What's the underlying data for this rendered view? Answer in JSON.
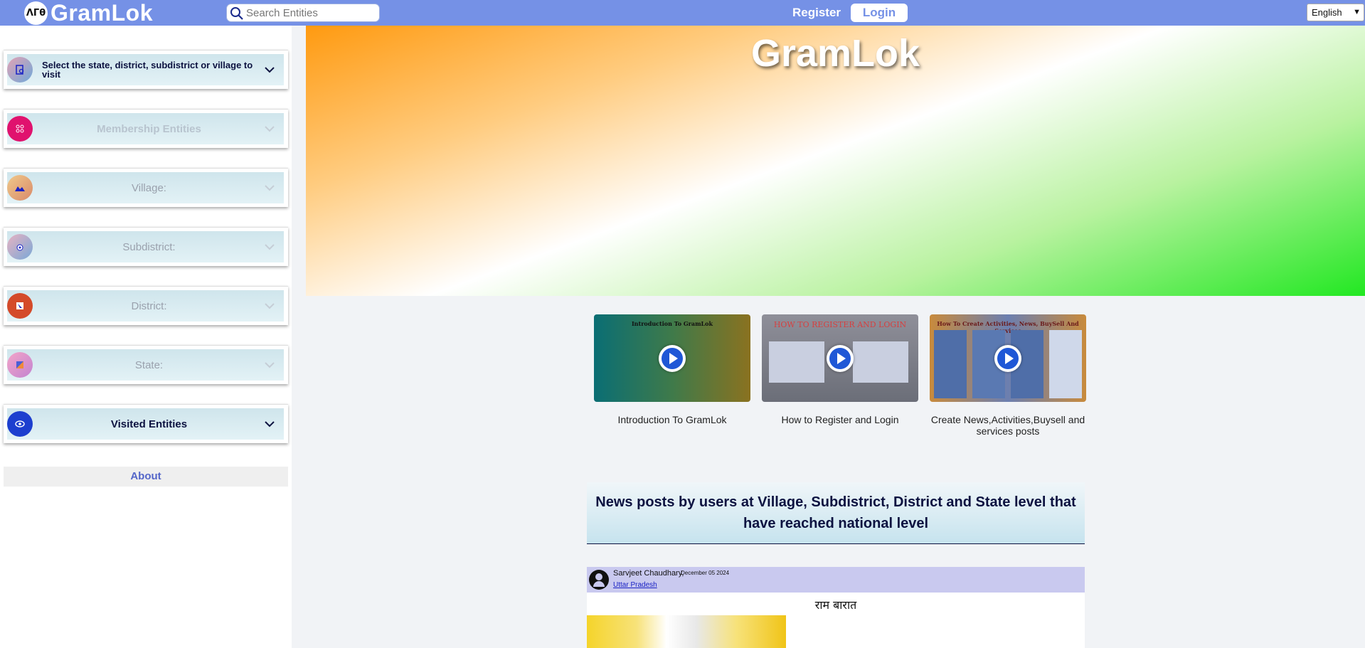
{
  "header": {
    "logo_mark": "ΛΓθ",
    "app_name": "GramLok",
    "search_placeholder": "Search Entities",
    "register_label": "Register",
    "login_label": "Login",
    "language": "English"
  },
  "sidebar": {
    "items": [
      {
        "label": "Select the state, district, subdistrict or village to visit",
        "icon": "select-location-icon"
      },
      {
        "label": "Membership Entities",
        "icon": "membership-icon"
      },
      {
        "label": "Village:",
        "icon": "village-icon"
      },
      {
        "label": "Subdistrict:",
        "icon": "subdistrict-icon"
      },
      {
        "label": "District:",
        "icon": "district-icon"
      },
      {
        "label": "State:",
        "icon": "state-icon"
      },
      {
        "label": "Visited Entities",
        "icon": "eye-icon"
      }
    ],
    "about_label": "About"
  },
  "banner": {
    "title": "GramLok"
  },
  "videos": [
    {
      "caption": "Introduction To GramLok",
      "thumb_title": "Introduction To GramLok"
    },
    {
      "caption": "How to Register and Login",
      "thumb_title": "HOW TO REGISTER AND LOGIN"
    },
    {
      "caption": "Create News,Activities,Buysell and services posts",
      "thumb_title": "How To Create Activities, News, BuySell And Services"
    }
  ],
  "news": {
    "heading": "News posts by users at Village, Subdistrict, District and State level that have reached national level",
    "post": {
      "author": "Sarvjeet Chaudhary,",
      "date": "December 05 2024",
      "state": "Uttar Pradesh",
      "title": "राम बारात"
    }
  },
  "colors": {
    "topbar": "#7591e6",
    "accent_dark": "#0c1240",
    "play": "#1f57d6"
  }
}
